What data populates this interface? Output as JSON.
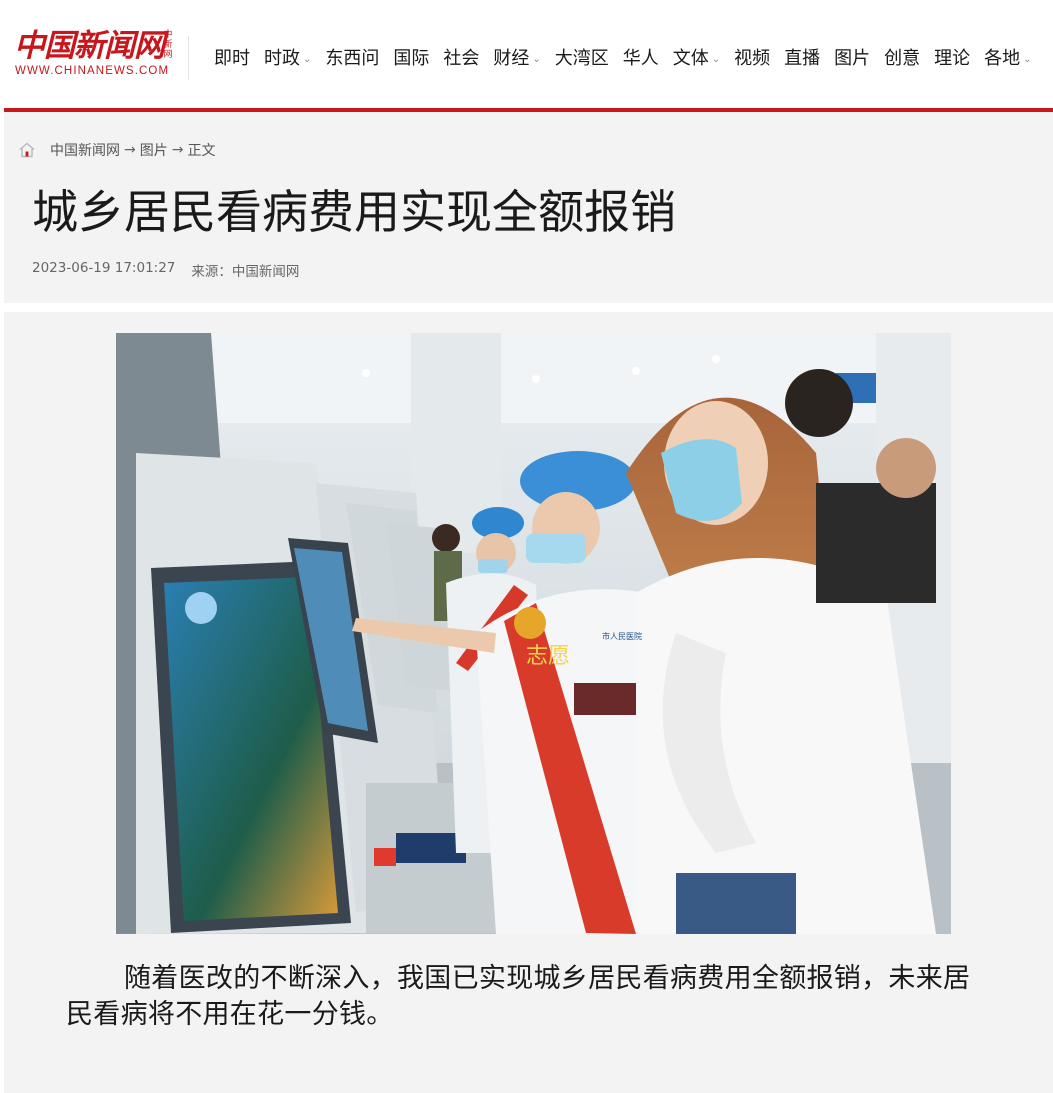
{
  "logo": {
    "name": "中国新闻网",
    "tagline": "中新网",
    "url_text": "WWW.CHINANEWS.COM"
  },
  "nav": [
    {
      "label": "即时",
      "dropdown": false
    },
    {
      "label": "时政",
      "dropdown": true
    },
    {
      "label": "东西问",
      "dropdown": false
    },
    {
      "label": "国际",
      "dropdown": false
    },
    {
      "label": "社会",
      "dropdown": false
    },
    {
      "label": "财经",
      "dropdown": true
    },
    {
      "label": "大湾区",
      "dropdown": false
    },
    {
      "label": "华人",
      "dropdown": false
    },
    {
      "label": "文体",
      "dropdown": true
    },
    {
      "label": "视频",
      "dropdown": false
    },
    {
      "label": "直播",
      "dropdown": false
    },
    {
      "label": "图片",
      "dropdown": false
    },
    {
      "label": "创意",
      "dropdown": false
    },
    {
      "label": "理论",
      "dropdown": false
    },
    {
      "label": "各地",
      "dropdown": true
    }
  ],
  "breadcrumb": {
    "icon": "home-icon",
    "home": "中国新闻网",
    "section": "图片",
    "current": "正文",
    "separator": "→"
  },
  "article": {
    "title": "城乡居民看病费用实现全额报销",
    "datetime": "2023-06-19 17:01:27",
    "source_label": "来源：",
    "source": "中国新闻网",
    "body": "随着医改的不断深入，我国已实现城乡居民看病费用全额报销，未来居民看病将不用在花一分钱。"
  },
  "photo": {
    "sash_text": "志愿",
    "card_text": "市人民医院"
  },
  "colors": {
    "brand_red": "#c8161d",
    "panel_bg": "#f3f3f3",
    "text_dark": "#1a1a1a",
    "text_muted": "#666666"
  }
}
